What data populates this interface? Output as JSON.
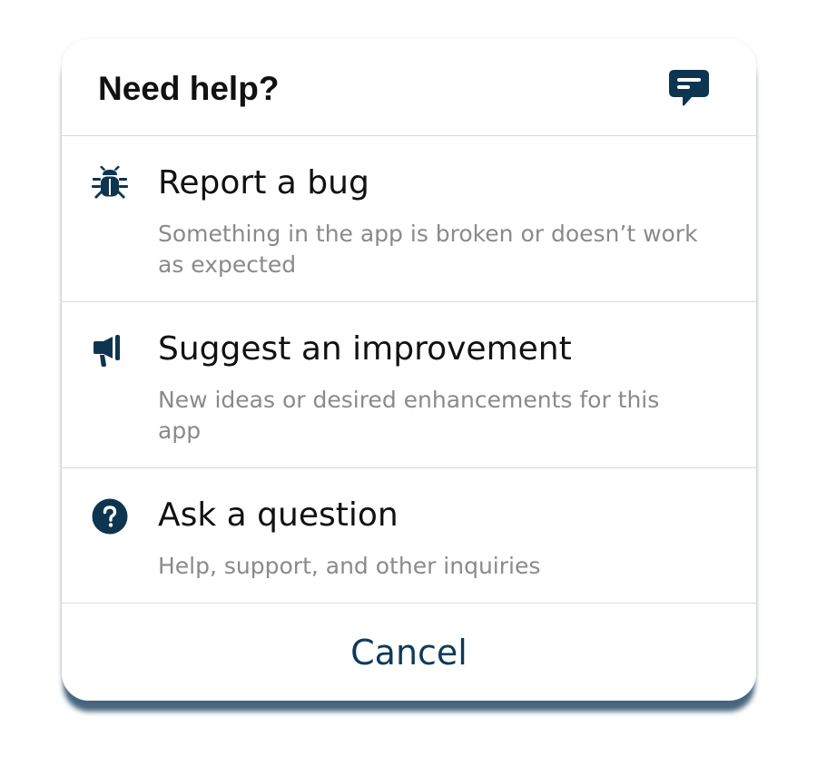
{
  "dialog": {
    "title": "Need help?",
    "header_icon": "chat-bubble-icon",
    "options": [
      {
        "icon": "bug-icon",
        "title": "Report a bug",
        "description": "Something in the app is broken or doesn’t work as expected"
      },
      {
        "icon": "megaphone-icon",
        "title": "Suggest an improvement",
        "description": "New ideas or desired enhancements for this app"
      },
      {
        "icon": "question-circle-icon",
        "title": "Ask a question",
        "description": "Help, support, and other inquiries"
      }
    ],
    "cancel_label": "Cancel"
  },
  "colors": {
    "accent": "#0e3a5b",
    "icon": "#0d3550",
    "title_text": "#111111",
    "secondary_text": "#8a8a8a",
    "divider": "#d9d9d9",
    "shadow": "#284b69"
  }
}
